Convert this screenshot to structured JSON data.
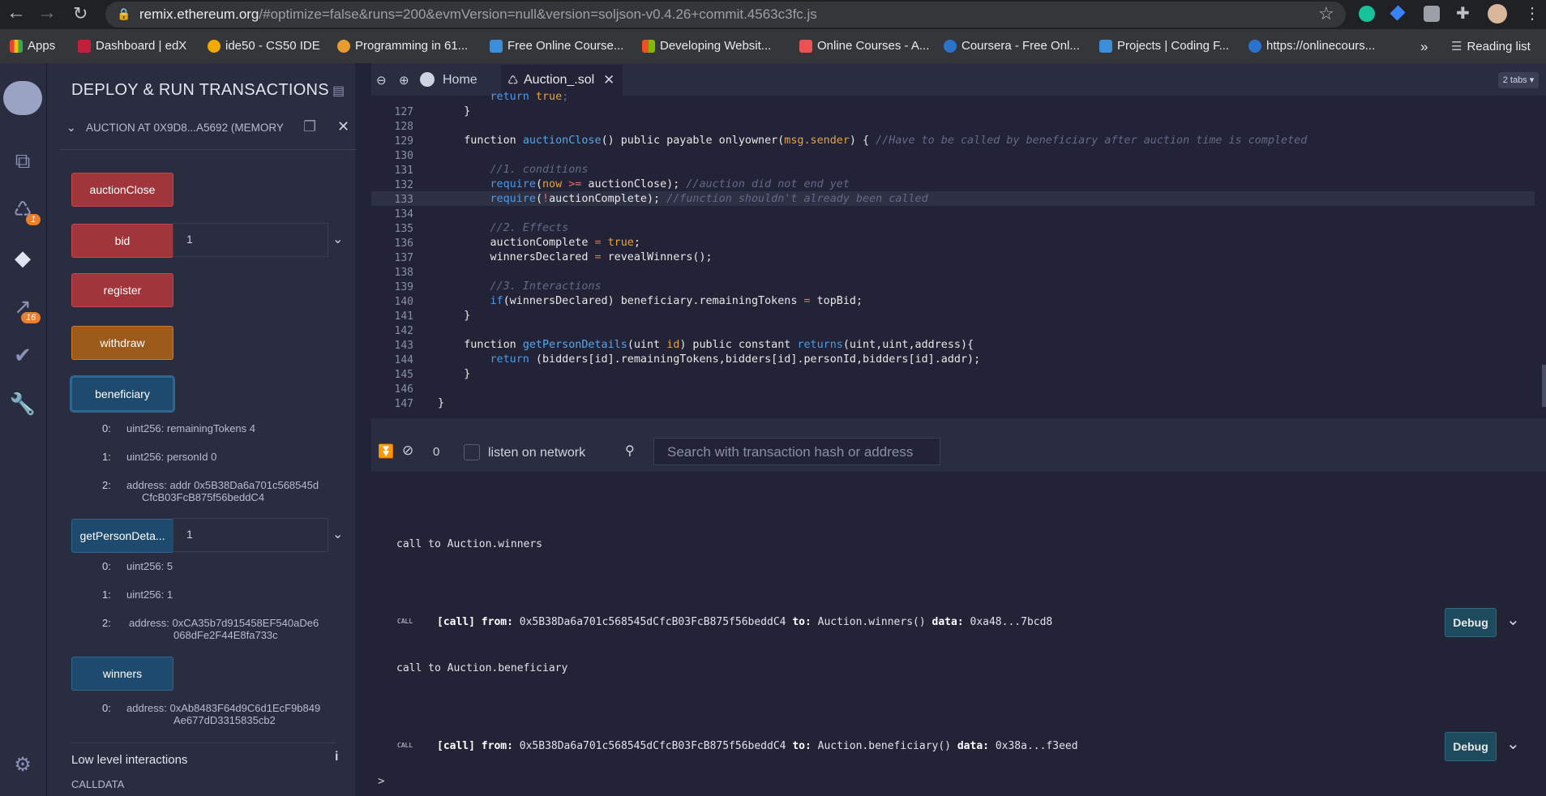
{
  "browser": {
    "url_host": "remix.ethereum.org",
    "url_rest": "/#optimize=false&runs=200&evmVersion=null&version=soljson-v0.4.26+commit.4563c3fc.js",
    "bookmarks": [
      "Apps",
      "Dashboard | edX",
      "ide50 - CS50 IDE",
      "Programming in 61...",
      "Free Online Course...",
      "Developing Websit...",
      "Online Courses - A...",
      "Coursera - Free Onl...",
      "Projects | Coding F...",
      "https://onlinecours..."
    ],
    "more": "»",
    "reading_list": "Reading list"
  },
  "rail": {
    "badge_compiler": "1",
    "badge_analysis": "16"
  },
  "panel": {
    "title": "DEPLOY & RUN TRANSACTIONS",
    "instance_label": "AUCTION AT 0X9D8...A5692 (MEMORY",
    "buttons": {
      "auctionClose": "auctionClose",
      "bid": "bid",
      "bid_value": "1",
      "register": "register",
      "withdraw": "withdraw",
      "beneficiary": "beneficiary",
      "getPersonDetails": "getPersonDeta...",
      "getPersonDetails_value": "1",
      "winners": "winners"
    },
    "beneficiary_out": [
      {
        "idx": "0:",
        "val": "uint256: remainingTokens 4"
      },
      {
        "idx": "1:",
        "val": "uint256: personId 0"
      },
      {
        "idx": "2:",
        "val": "address: addr 0x5B38Da6a701c568545d",
        "val2": "CfcB03FcB875f56beddC4"
      }
    ],
    "person_out": [
      {
        "idx": "0:",
        "val": "uint256: 5"
      },
      {
        "idx": "1:",
        "val": "uint256: 1"
      },
      {
        "idx": "2:",
        "val": "address: 0xCA35b7d915458EF540aDe6",
        "val2": "068dFe2F44E8fa733c"
      }
    ],
    "winners_out": {
      "idx": "0:",
      "val": "address: 0xAb8483F64d9C6d1EcF9b849",
      "val2": "Ae677dD3315835cb2"
    },
    "low_level": "Low level interactions",
    "calldata": "CALLDATA"
  },
  "tabs": {
    "home": "Home",
    "file": "Auction_.sol",
    "count": "2 tabs"
  },
  "editor": {
    "line_numbers": [
      "127",
      "128",
      "129",
      "130",
      "131",
      "132",
      "133",
      "134",
      "135",
      "136",
      "137",
      "138",
      "139",
      "140",
      "141",
      "142",
      "143",
      "144",
      "145",
      "146",
      "147"
    ]
  },
  "terminal": {
    "count": "0",
    "listen": "listen on network",
    "search_placeholder": "Search with transaction hash or address",
    "call1_title": "call to Auction.winners",
    "call1_line": "0x5B38Da6a701c568545dCfcB03FcB875f56beddC4",
    "call1_to": "Auction.winners()",
    "call1_data": "0xa48...7bcd8",
    "call2_title": "call to Auction.beneficiary",
    "call2_line": "0x5B38Da6a701c568545dCfcB03FcB875f56beddC4",
    "call2_to": "Auction.beneficiary()",
    "call2_data": "0x38a...f3eed",
    "call_tag": "CALL",
    "call_kw": "[call]",
    "from_kw": "from:",
    "to_kw": "to:",
    "data_kw": "data:",
    "debug": "Debug",
    "prompt": ">"
  }
}
